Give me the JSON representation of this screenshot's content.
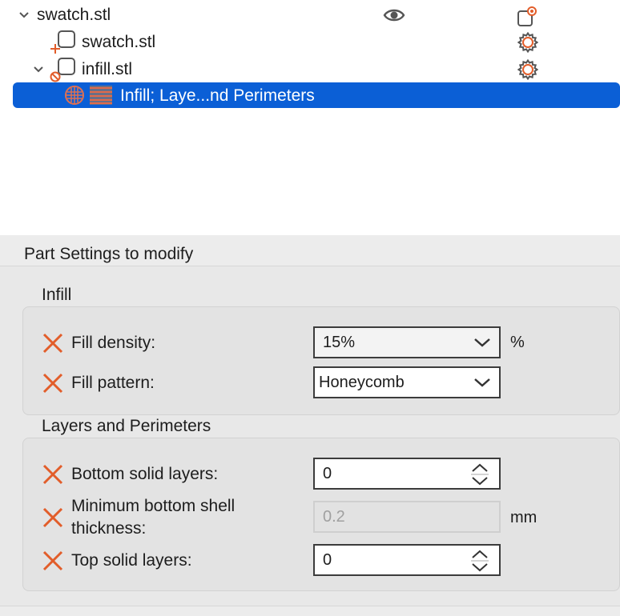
{
  "tree": {
    "root": {
      "label": "swatch.stl"
    },
    "children": [
      {
        "label": "swatch.stl"
      },
      {
        "label": "infill.stl"
      }
    ],
    "selected": {
      "label": "Infill; Laye...nd Perimeters"
    }
  },
  "settings": {
    "title": "Part Settings to modify",
    "groups": [
      {
        "title": "Infill",
        "fields": [
          {
            "label": "Fill density:",
            "value": "15%",
            "unit": "%"
          },
          {
            "label": "Fill pattern:",
            "value": "Honeycomb"
          }
        ]
      },
      {
        "title": "Layers and Perimeters",
        "fields": [
          {
            "label": "Bottom solid layers:",
            "value": "0"
          },
          {
            "label_line1": "Minimum bottom shell",
            "label_line2": "thickness:",
            "value": "0.2",
            "unit": "mm"
          },
          {
            "label": "Top solid layers:",
            "value": "0"
          }
        ]
      }
    ]
  },
  "colors": {
    "accent": "#e25d2a",
    "selection": "#0b5fd6"
  },
  "icons": [
    "chevron-down-icon",
    "eye-icon",
    "settings-object-icon",
    "gear-icon",
    "part-icon",
    "modifier-icon",
    "infill-icon",
    "layers-icon",
    "remove-x-icon",
    "stepper-icon"
  ]
}
